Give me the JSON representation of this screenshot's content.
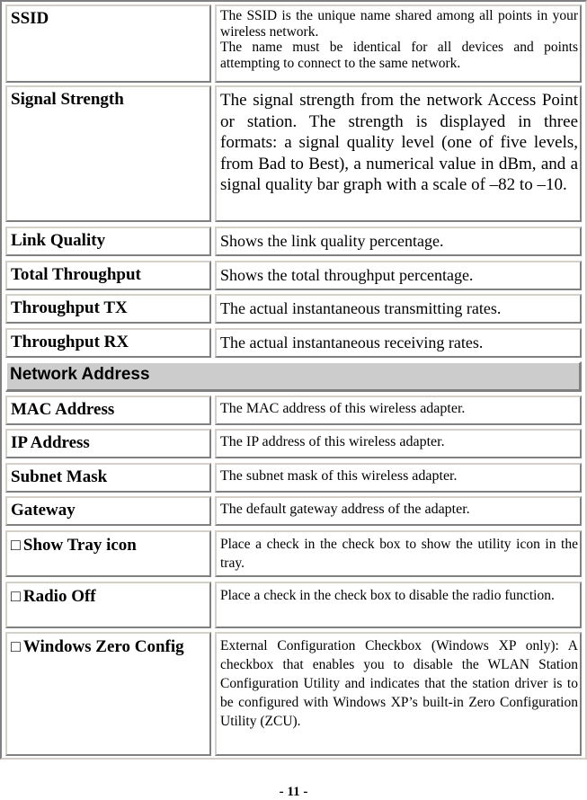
{
  "rows": {
    "ssid": {
      "term": "SSID",
      "desc": [
        "The SSID is the unique name shared among all points in your wireless network.",
        "The name must be identical for all devices and points attempting to connect to the same network."
      ]
    },
    "signal_strength": {
      "term": "Signal Strength",
      "desc": "The signal strength from the network Access Point or station. The strength is displayed in three formats: a signal quality level (one of five levels, from Bad to Best), a numerical value in dBm, and a signal quality bar graph with a scale of –82 to –10."
    },
    "link_quality": {
      "term": "Link Quality",
      "desc": "Shows the link quality percentage."
    },
    "total_throughput": {
      "term": "Total Throughput",
      "desc": "Shows the total throughput percentage."
    },
    "throughput_tx": {
      "term": "Throughput TX",
      "desc": "The actual instantaneous transmitting rates."
    },
    "throughput_rx": {
      "term": "Throughput RX",
      "desc": "The actual instantaneous receiving rates."
    },
    "section_network_address": {
      "label": "Network Address"
    },
    "mac_address": {
      "term": "MAC Address",
      "desc": "The MAC address of this wireless adapter."
    },
    "ip_address": {
      "term": "IP Address",
      "desc": "The IP address of this wireless adapter."
    },
    "subnet_mask": {
      "term": "Subnet Mask",
      "desc": "The subnet mask of this wireless adapter."
    },
    "gateway": {
      "term": "Gateway",
      "desc": "The default gateway address of the adapter."
    },
    "show_tray_icon": {
      "checkbox_glyph": "□",
      "term": "Show Tray icon",
      "desc": "Place a check in the check box to show the utility icon in the tray."
    },
    "radio_off": {
      "checkbox_glyph": "□",
      "term": "Radio Off",
      "desc": "Place a check in the check box to disable the radio function."
    },
    "windows_zero_config": {
      "checkbox_glyph": "□",
      "term": "Windows Zero Config",
      "desc": "External Configuration Checkbox (Windows XP only): A checkbox that enables you to disable the WLAN Station Configuration Utility and indicates that the station driver is to be configured with Windows XP’s built-in Zero Configuration Utility (ZCU)."
    }
  },
  "footer": {
    "page_number": "- 11 -"
  }
}
